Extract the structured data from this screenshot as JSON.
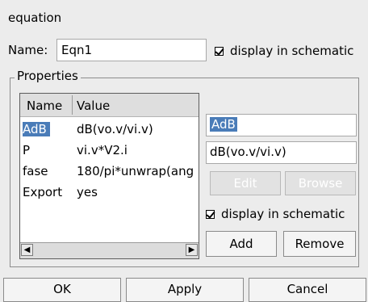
{
  "dialog": {
    "title": "equation",
    "name_label": "Name:",
    "name_value": "Eqn1",
    "display_schematic_label": "display in schematic",
    "display_schematic_checked": true
  },
  "properties": {
    "group_label": "Properties",
    "columns": [
      "Name",
      "Value"
    ],
    "rows": [
      {
        "name": "AdB",
        "value": "dB(vo.v/vi.v)",
        "selected": true
      },
      {
        "name": "P",
        "value": "vi.v*V2.i",
        "selected": false
      },
      {
        "name": "fase",
        "value": "180/pi*unwrap(ang",
        "selected": false
      },
      {
        "name": "Export",
        "value": "yes",
        "selected": false
      }
    ],
    "scroll_left_icon": "arrow-left",
    "scroll_right_icon": "arrow-right",
    "selected_name": "AdB",
    "selected_value": "dB(vo.v/vi.v)",
    "edit_label": "Edit",
    "browse_label": "Browse",
    "display_schematic_label": "display in schematic",
    "display_schematic_checked": true,
    "add_label": "Add",
    "remove_label": "Remove"
  },
  "buttons": {
    "ok": "OK",
    "apply": "Apply",
    "cancel": "Cancel"
  },
  "colors": {
    "selection": "#4a7cb8",
    "background": "#ececec"
  }
}
